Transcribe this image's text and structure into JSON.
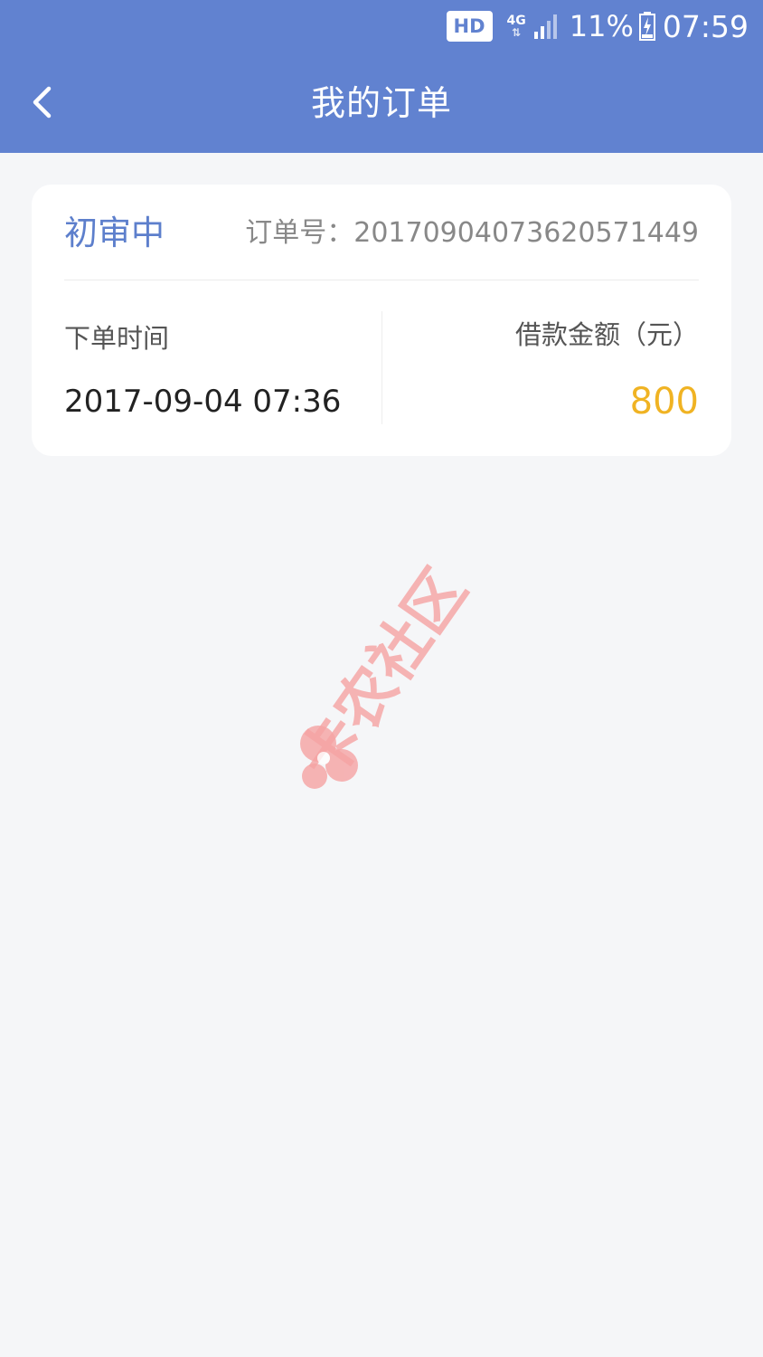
{
  "status_bar": {
    "hd_label": "HD",
    "network_label": "4G",
    "battery_percent": "11%",
    "time": "07:59"
  },
  "nav": {
    "title": "我的订单"
  },
  "order": {
    "status": "初审中",
    "order_no_text": "订单号：20170904073620571449",
    "order_time_label": "下单时间",
    "order_time_value": "2017-09-04 07:36",
    "loan_amount_label": "借款金额（元）",
    "loan_amount_value": "800"
  },
  "watermark": {
    "text": "卡农社区"
  },
  "colors": {
    "header": "#6182d0",
    "status_accent": "#5d7fcc",
    "amount": "#f0b323",
    "watermark": "#f5a3a3"
  }
}
